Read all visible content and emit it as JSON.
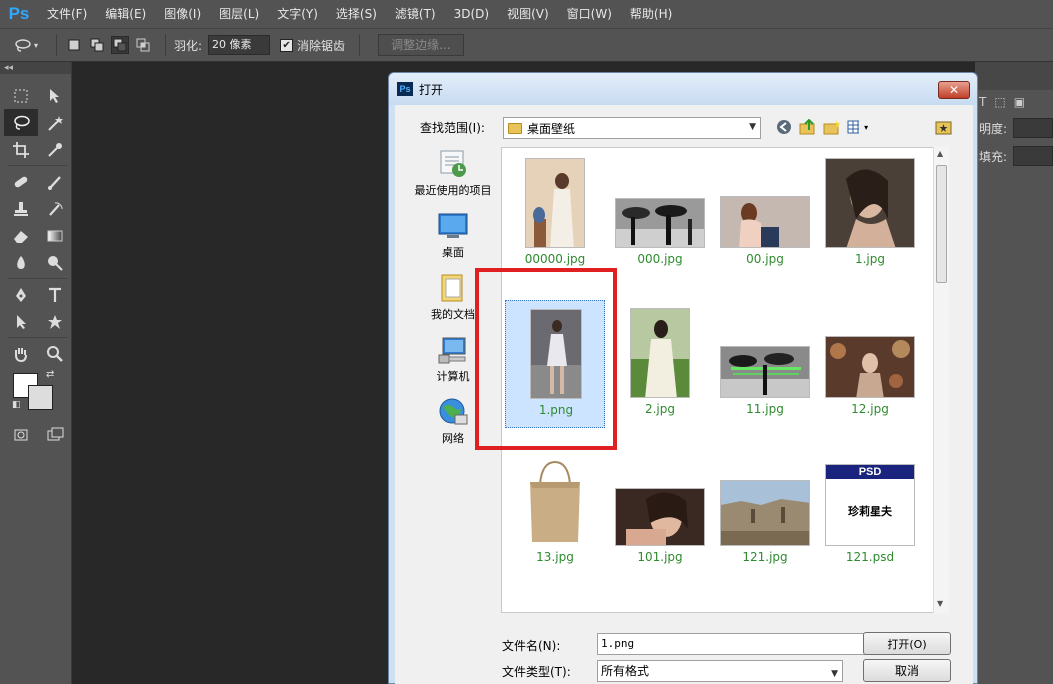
{
  "app": {
    "logo": "Ps"
  },
  "menu": [
    "文件(F)",
    "编辑(E)",
    "图像(I)",
    "图层(L)",
    "文字(Y)",
    "选择(S)",
    "滤镜(T)",
    "3D(D)",
    "视图(V)",
    "窗口(W)",
    "帮助(H)"
  ],
  "options": {
    "feather_label": "羽化:",
    "feather_value": "20 像素",
    "antialias_label": "消除锯齿",
    "antialias_checked": true,
    "refine_edge_label": "调整边缘..."
  },
  "tool_panel": {
    "collapse_glyph": "◂◂"
  },
  "right_panel": {
    "opacity_label": "明度:",
    "fill_label": "填充:"
  },
  "dialog": {
    "title": "打开",
    "close_label": "✕",
    "lookin_label": "查找范围(I):",
    "lookin_value": "桌面壁纸",
    "places": [
      "最近使用的项目",
      "桌面",
      "我的文档",
      "计算机",
      "网络"
    ],
    "files": [
      {
        "name": "00000.jpg",
        "icon": "photo-portrait"
      },
      {
        "name": "000.jpg",
        "icon": "photo-street"
      },
      {
        "name": "00.jpg",
        "icon": "photo-woman-sitting"
      },
      {
        "name": "1.jpg",
        "icon": "photo-portrait-dark"
      },
      {
        "name": "1.png",
        "icon": "photo-woman-walking",
        "selected": true
      },
      {
        "name": "2.jpg",
        "icon": "photo-woman-grass"
      },
      {
        "name": "11.jpg",
        "icon": "photo-street-green"
      },
      {
        "name": "12.jpg",
        "icon": "photo-bokeh"
      },
      {
        "name": "13.jpg",
        "icon": "shopping-bag"
      },
      {
        "name": "101.jpg",
        "icon": "photo-face"
      },
      {
        "name": "121.jpg",
        "icon": "photo-ruins"
      },
      {
        "name": "121.psd",
        "icon": "psd-document",
        "badge": "PSD",
        "caption_text": "珍莉星夫"
      }
    ],
    "filename_label": "文件名(N):",
    "filename_value": "1.png",
    "filetype_label": "文件类型(T):",
    "filetype_value": "所有格式",
    "open_label": "打开(O)",
    "cancel_label": "取消"
  },
  "colors": {
    "accent_highlight": "#e02020",
    "selection": "#cce4ff",
    "caption_green": "#2e8b2e"
  }
}
